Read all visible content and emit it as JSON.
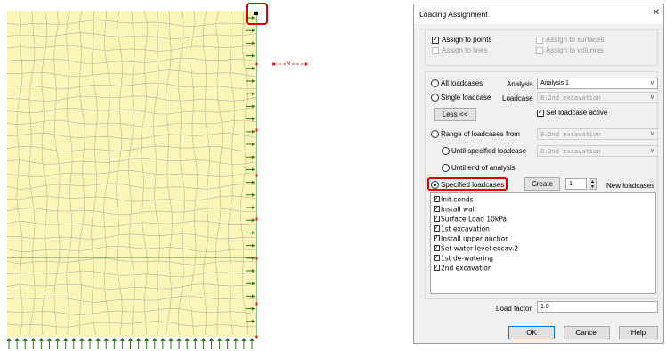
{
  "mesh": {
    "colors": {
      "fill": "#fbf5b8",
      "grid": "#b8b49a",
      "line": "#4a9a2a",
      "arrow": "#2a7a1a",
      "point": "#e02020",
      "highlight": "#e00000"
    },
    "axis_label": "Y"
  },
  "dialog": {
    "title": "Loading Assignment",
    "close_icon": "close-icon",
    "assign": {
      "points": "Assign to points",
      "surfaces": "Assign to surfaces",
      "lines": "Assign to lines",
      "volumes": "Assign to volumes"
    },
    "all_loadcases": {
      "label": "All loadcases",
      "analysis_label": "Analysis",
      "analysis_value": "Analysis 1"
    },
    "single_loadcase": {
      "label": "Single loadcase",
      "loadcase_label": "Loadcase",
      "loadcase_value": "8:2nd excavation"
    },
    "less_button": "Less <<",
    "set_active": "Set loadcase active",
    "range": {
      "label": "Range of loadcases from",
      "value": "8:2nd excavation"
    },
    "until_specified": {
      "label": "Until specified loadcase",
      "value": "8:2nd excavation"
    },
    "until_end": "Until end of analysis",
    "specified": "Specified loadcases",
    "create_button": "Create",
    "create_count": "1",
    "new_loadcases": "New loadcases",
    "loadcases": [
      {
        "label": "Init.conds",
        "checked": true
      },
      {
        "label": "Install wall",
        "checked": true
      },
      {
        "label": "Surface Load 10kPa",
        "checked": true
      },
      {
        "label": "1st excavation",
        "checked": true
      },
      {
        "label": "Install upper anchor",
        "checked": true
      },
      {
        "label": "Set water level excav.2",
        "checked": true
      },
      {
        "label": "1st de-watering",
        "checked": true
      },
      {
        "label": "2nd excavation",
        "checked": true
      }
    ],
    "load_factor_label": "Load factor",
    "load_factor_value": "1.0",
    "ok_button": "OK",
    "cancel_button": "Cancel",
    "help_button": "Help"
  }
}
